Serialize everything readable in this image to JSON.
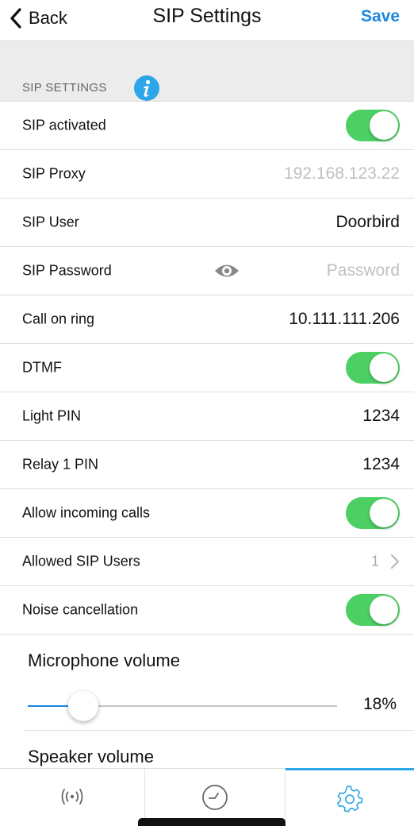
{
  "navbar": {
    "back_label": "Back",
    "title": "SIP Settings",
    "save_label": "Save"
  },
  "section": {
    "label": "SIP SETTINGS"
  },
  "rows": {
    "sip_activated": {
      "label": "SIP activated",
      "toggle": true
    },
    "sip_proxy": {
      "label": "SIP Proxy",
      "placeholder": "192.168.123.22",
      "value": ""
    },
    "sip_user": {
      "label": "SIP User",
      "value": "Doorbird"
    },
    "sip_password": {
      "label": "SIP Password",
      "placeholder": "Password",
      "value": ""
    },
    "call_on_ring": {
      "label": "Call on ring",
      "value": "10.111.111.206"
    },
    "dtmf": {
      "label": "DTMF",
      "toggle": true
    },
    "light_pin": {
      "label": "Light PIN",
      "value": "1234"
    },
    "relay_pin": {
      "label": "Relay 1 PIN",
      "value": "1234"
    },
    "allow_incoming": {
      "label": "Allow incoming calls",
      "toggle": true
    },
    "allowed_users": {
      "label": "Allowed SIP Users",
      "value": "1"
    },
    "noise_cancellation": {
      "label": "Noise cancellation",
      "toggle": true
    }
  },
  "microphone": {
    "title": "Microphone volume",
    "value_label": "18%",
    "fraction": 0.18
  },
  "speaker": {
    "title": "Speaker volume"
  },
  "tabs": [
    {
      "icon": "broadcast-icon",
      "active": false
    },
    {
      "icon": "history-icon",
      "active": false
    },
    {
      "icon": "settings-gear-icon",
      "active": true
    }
  ],
  "colors": {
    "accent": "#1e87e0",
    "toggle_on": "#4cd064",
    "info": "#2da6e8"
  }
}
